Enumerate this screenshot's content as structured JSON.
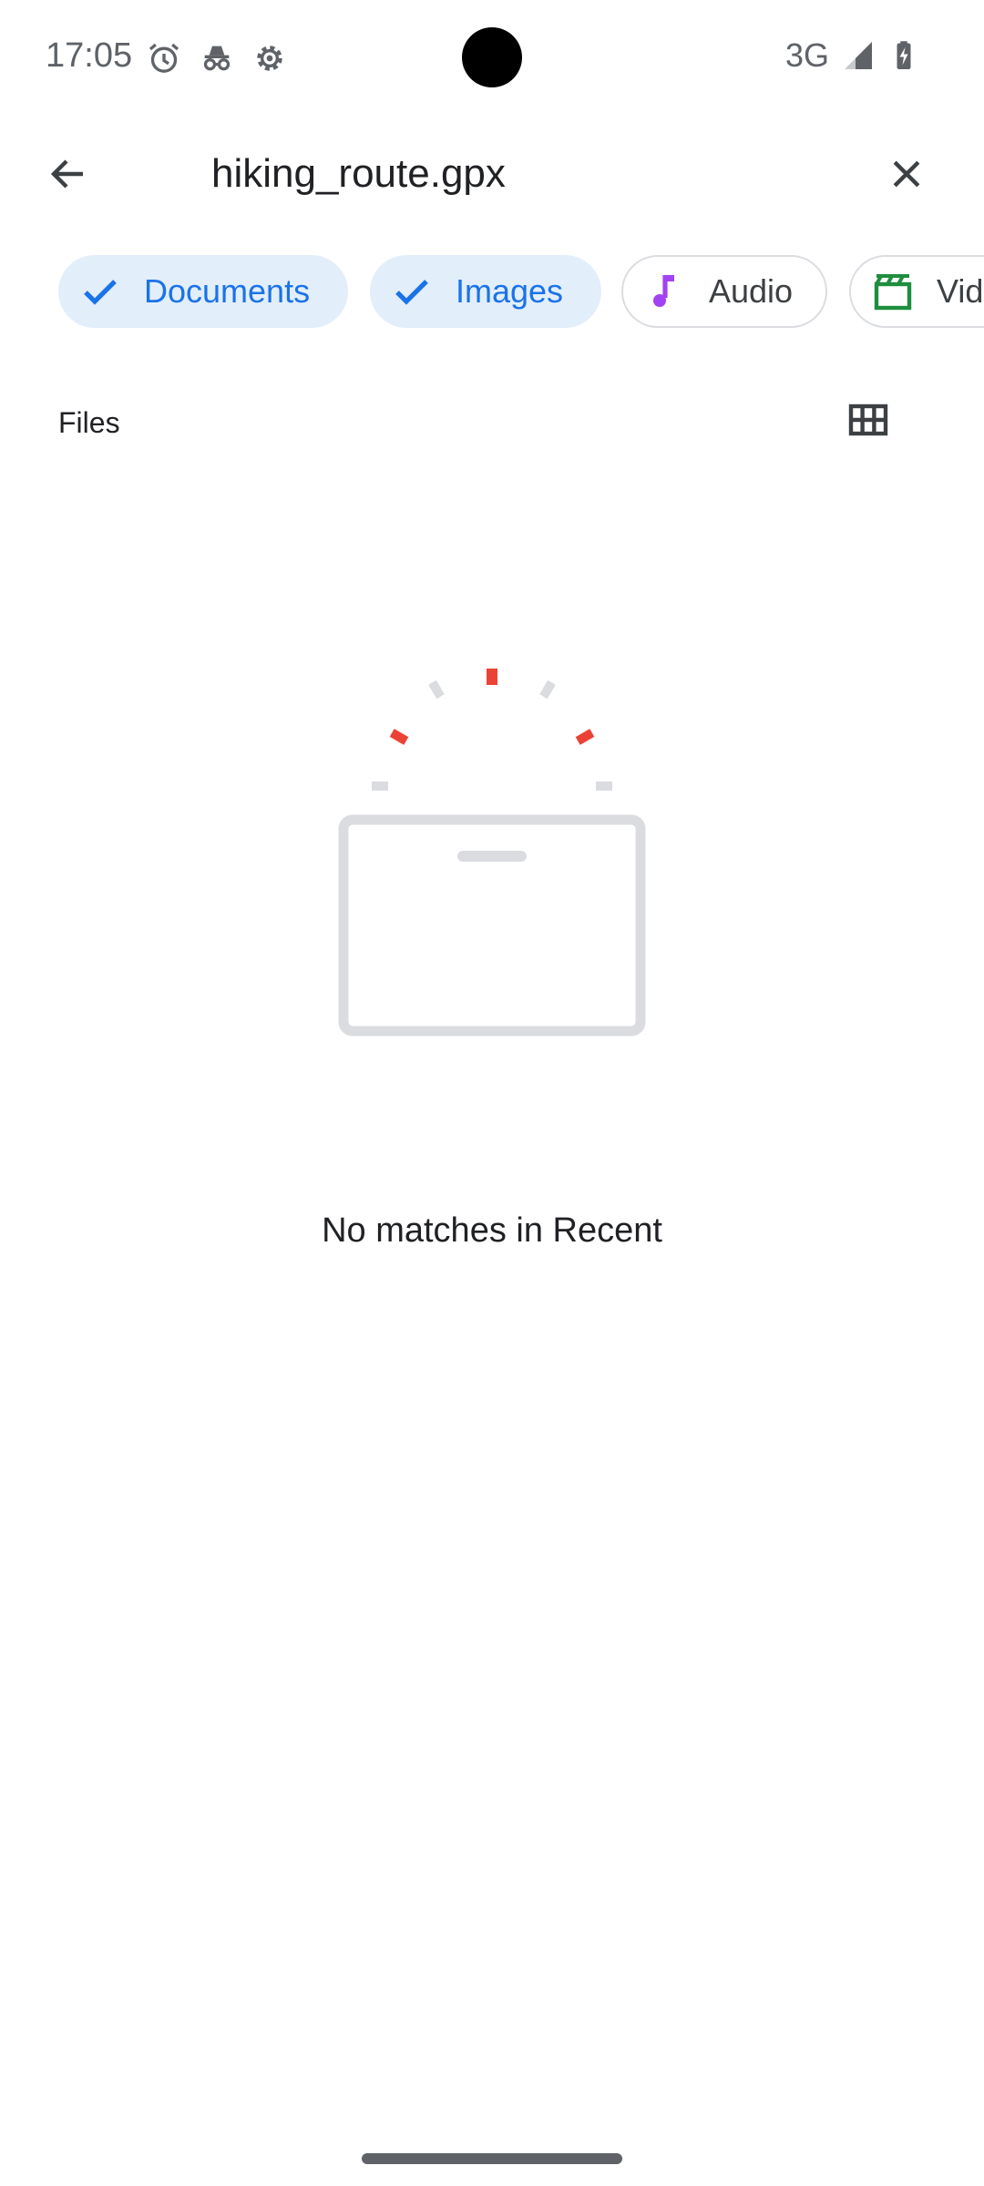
{
  "status_bar": {
    "time": "17:05",
    "left_icons": [
      "alarm-icon",
      "incognito-icon",
      "settings-gear-icon"
    ],
    "network": "3G",
    "right_icons": [
      "cell-signal-icon",
      "battery-charging-icon"
    ]
  },
  "toolbar": {
    "search_value": "hiking_route.gpx",
    "back_icon": "arrow-back-icon",
    "clear_icon": "close-icon"
  },
  "filter_chips": [
    {
      "label": "Documents",
      "selected": true,
      "icon": "check-icon"
    },
    {
      "label": "Images",
      "selected": true,
      "icon": "check-icon"
    },
    {
      "label": "Audio",
      "selected": false,
      "icon": "music-note-icon",
      "icon_color": "#a142f4"
    },
    {
      "label": "Vid",
      "selected": false,
      "icon": "movie-clapper-icon",
      "icon_color": "#1e8e3e"
    }
  ],
  "files_section": {
    "title": "Files",
    "view_toggle_icon": "grid-view-icon"
  },
  "empty_state": {
    "illustration": "empty-box-illustration",
    "message": "No matches in Recent"
  },
  "colors": {
    "accent": "#1a73e8",
    "chip_selected_bg": "#e3eefb",
    "illustration_red": "#ea4335",
    "illustration_gray": "#dadce0"
  }
}
